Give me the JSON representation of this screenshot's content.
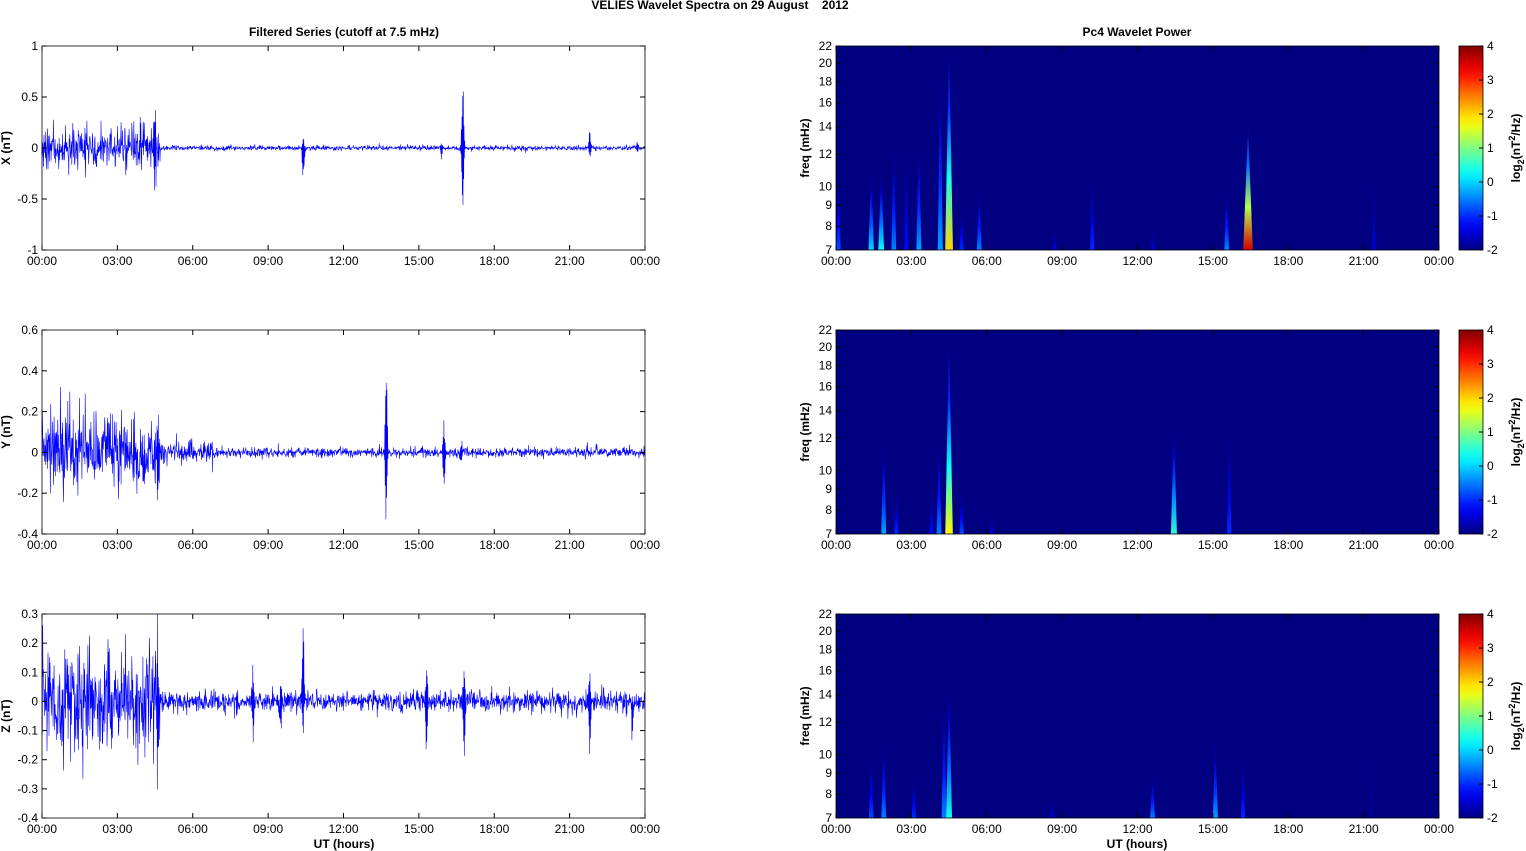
{
  "title": "VELIES Wavelet Spectra on 29 August    2012",
  "left_title": "Filtered Series (cutoff at 7.5 mHz)",
  "right_title": "Pc4 Wavelet Power",
  "xlabel": "UT (hours)",
  "freq_label": "freq (mHz)",
  "colorbar_label": {
    "a": "log",
    "sub": "2",
    "b": "(nT",
    "sup": "2",
    "c": "/Hz)"
  },
  "chart_data": [
    {
      "type": "line",
      "name": "X",
      "ylabel": "X (nT)",
      "xlim": [
        0,
        24
      ],
      "ylim": [
        -1,
        1
      ],
      "yticks": [
        -1,
        -0.5,
        0,
        0.5,
        1
      ],
      "xticks": [
        0,
        3,
        6,
        9,
        12,
        15,
        18,
        21,
        24
      ],
      "xticklabels": [
        "00:00",
        "03:00",
        "06:00",
        "09:00",
        "12:00",
        "15:00",
        "18:00",
        "21:00",
        "00:00"
      ],
      "noise_envelope": [
        {
          "from": 0,
          "to": 4.7,
          "amp": 0.1
        },
        {
          "from": 4.7,
          "to": 24,
          "amp": 0.012
        }
      ],
      "spikes": [
        {
          "t": 10.4,
          "pos": 0.1,
          "neg": -0.35
        },
        {
          "t": 15.9,
          "pos": 0.08,
          "neg": -0.1
        },
        {
          "t": 16.75,
          "pos": 0.75,
          "neg": -0.67
        },
        {
          "t": 21.8,
          "pos": 0.18,
          "neg": -0.08
        },
        {
          "t": 23.7,
          "pos": 0.08,
          "neg": -0.05
        },
        {
          "t": 4.5,
          "pos": 0.28,
          "neg": -0.35
        }
      ]
    },
    {
      "type": "line",
      "name": "Y",
      "ylabel": "Y (nT)",
      "xlim": [
        0,
        24
      ],
      "ylim": [
        -0.4,
        0.6
      ],
      "yticks": [
        -0.4,
        -0.2,
        0,
        0.2,
        0.4,
        0.6
      ],
      "xticks": [
        0,
        3,
        6,
        9,
        12,
        15,
        18,
        21,
        24
      ],
      "xticklabels": [
        "00:00",
        "03:00",
        "06:00",
        "09:00",
        "12:00",
        "15:00",
        "18:00",
        "21:00",
        "00:00"
      ],
      "noise_envelope": [
        {
          "from": 0,
          "to": 4.7,
          "amp": 0.09
        },
        {
          "from": 4.7,
          "to": 7,
          "amp": 0.025
        },
        {
          "from": 7,
          "to": 24,
          "amp": 0.012
        }
      ],
      "spikes": [
        {
          "t": 4.6,
          "pos": 0.25,
          "neg": -0.33
        },
        {
          "t": 13.7,
          "pos": 0.42,
          "neg": -0.36
        },
        {
          "t": 16.0,
          "pos": 0.15,
          "neg": -0.2
        },
        {
          "t": 16.7,
          "pos": 0.05,
          "neg": -0.08
        }
      ]
    },
    {
      "type": "line",
      "name": "Z",
      "ylabel": "Z (nT)",
      "xlim": [
        0,
        24
      ],
      "ylim": [
        -0.4,
        0.3
      ],
      "yticks": [
        -0.4,
        -0.3,
        -0.2,
        -0.1,
        0,
        0.1,
        0.2,
        0.3
      ],
      "xticks": [
        0,
        3,
        6,
        9,
        12,
        15,
        18,
        21,
        24
      ],
      "xticklabels": [
        "00:00",
        "03:00",
        "06:00",
        "09:00",
        "12:00",
        "15:00",
        "18:00",
        "21:00",
        "00:00"
      ],
      "noise_envelope": [
        {
          "from": 0,
          "to": 4.7,
          "amp": 0.09
        },
        {
          "from": 4.7,
          "to": 24,
          "amp": 0.018
        }
      ],
      "spikes": [
        {
          "t": 4.6,
          "pos": 0.2,
          "neg": -0.26
        },
        {
          "t": 8.4,
          "pos": 0.09,
          "neg": -0.14
        },
        {
          "t": 9.5,
          "pos": 0.05,
          "neg": -0.15
        },
        {
          "t": 10.4,
          "pos": 0.28,
          "neg": -0.12
        },
        {
          "t": 15.3,
          "pos": 0.15,
          "neg": -0.22
        },
        {
          "t": 16.8,
          "pos": 0.13,
          "neg": -0.2
        },
        {
          "t": 21.8,
          "pos": 0.13,
          "neg": -0.2
        },
        {
          "t": 23.5,
          "pos": 0.03,
          "neg": -0.1
        }
      ]
    },
    {
      "type": "heatmap",
      "name": "X power",
      "ylabel": "freq (mHz)",
      "xlim": [
        0,
        24
      ],
      "ylim": [
        7,
        22
      ],
      "yscale": "log",
      "yticks": [
        7,
        8,
        9,
        10,
        12,
        14,
        16,
        18,
        20,
        22
      ],
      "clim": [
        -2,
        4
      ],
      "cticks": [
        -2,
        -1,
        0,
        1,
        2,
        3,
        4
      ],
      "xticks": [
        0,
        3,
        6,
        9,
        12,
        15,
        18,
        21,
        24
      ],
      "xticklabels": [
        "00:00",
        "03:00",
        "06:00",
        "09:00",
        "12:00",
        "15:00",
        "18:00",
        "21:00",
        "00:00"
      ],
      "bursts": [
        {
          "t": 0.1,
          "fmax": 11,
          "p": -0.8
        },
        {
          "t": 1.4,
          "fmax": 11,
          "p": 0
        },
        {
          "t": 1.8,
          "fmax": 11,
          "p": 0.3
        },
        {
          "t": 2.3,
          "fmax": 13,
          "p": -0.5
        },
        {
          "t": 2.8,
          "fmax": 13,
          "p": -1.2
        },
        {
          "t": 3.3,
          "fmax": 13,
          "p": -0.3
        },
        {
          "t": 4.15,
          "fmax": 20,
          "p": -0.3
        },
        {
          "t": 4.5,
          "fmax": 22,
          "p": 2
        },
        {
          "t": 5.0,
          "fmax": 9,
          "p": -1
        },
        {
          "t": 5.7,
          "fmax": 10,
          "p": -0.5
        },
        {
          "t": 8.7,
          "fmax": 8,
          "p": -1.5
        },
        {
          "t": 10.2,
          "fmax": 11,
          "p": -1
        },
        {
          "t": 12.6,
          "fmax": 8,
          "p": -1.5
        },
        {
          "t": 15.55,
          "fmax": 10,
          "p": -0.5
        },
        {
          "t": 16.4,
          "fmax": 14,
          "p": 3.5
        },
        {
          "t": 21.4,
          "fmax": 11,
          "p": -1.5
        }
      ]
    },
    {
      "type": "heatmap",
      "name": "Y power",
      "ylabel": "freq (mHz)",
      "xlim": [
        0,
        24
      ],
      "ylim": [
        7,
        22
      ],
      "yscale": "log",
      "yticks": [
        7,
        8,
        9,
        10,
        12,
        14,
        16,
        18,
        20,
        22
      ],
      "clim": [
        -2,
        4
      ],
      "cticks": [
        -2,
        -1,
        0,
        1,
        2,
        3,
        4
      ],
      "xticks": [
        0,
        3,
        6,
        9,
        12,
        15,
        18,
        21,
        24
      ],
      "xticklabels": [
        "00:00",
        "03:00",
        "06:00",
        "09:00",
        "12:00",
        "15:00",
        "18:00",
        "21:00",
        "00:00"
      ],
      "bursts": [
        {
          "t": 1.9,
          "fmax": 12,
          "p": -0.3
        },
        {
          "t": 2.4,
          "fmax": 9,
          "p": -1
        },
        {
          "t": 3.8,
          "fmax": 9,
          "p": -1.2
        },
        {
          "t": 4.1,
          "fmax": 12,
          "p": -0.5
        },
        {
          "t": 4.5,
          "fmax": 21,
          "p": 1.8
        },
        {
          "t": 5.0,
          "fmax": 9,
          "p": -0.8
        },
        {
          "t": 6.2,
          "fmax": 8,
          "p": -1.5
        },
        {
          "t": 13.45,
          "fmax": 13,
          "p": 0.5
        },
        {
          "t": 15.65,
          "fmax": 13,
          "p": -1
        }
      ]
    },
    {
      "type": "heatmap",
      "name": "Z power",
      "ylabel": "freq (mHz)",
      "xlim": [
        0,
        24
      ],
      "ylim": [
        7,
        22
      ],
      "yscale": "log",
      "yticks": [
        7,
        8,
        9,
        10,
        12,
        14,
        16,
        18,
        20,
        22
      ],
      "clim": [
        -2,
        4
      ],
      "cticks": [
        -2,
        -1,
        0,
        1,
        2,
        3,
        4
      ],
      "xticks": [
        0,
        3,
        6,
        9,
        12,
        15,
        18,
        21,
        24
      ],
      "xticklabels": [
        "00:00",
        "03:00",
        "06:00",
        "09:00",
        "12:00",
        "15:00",
        "18:00",
        "21:00",
        "00:00"
      ],
      "bursts": [
        {
          "t": 1.4,
          "fmax": 10,
          "p": -0.8
        },
        {
          "t": 1.9,
          "fmax": 11,
          "p": -0.5
        },
        {
          "t": 3.1,
          "fmax": 9,
          "p": -1
        },
        {
          "t": 4.3,
          "fmax": 14,
          "p": -0.5
        },
        {
          "t": 4.5,
          "fmax": 15,
          "p": 0.4
        },
        {
          "t": 8.6,
          "fmax": 8,
          "p": -1.5
        },
        {
          "t": 12.6,
          "fmax": 9,
          "p": -0.5
        },
        {
          "t": 15.1,
          "fmax": 11,
          "p": -0.3
        },
        {
          "t": 16.2,
          "fmax": 10,
          "p": -1
        },
        {
          "t": 21.3,
          "fmax": 11,
          "p": -1.8
        }
      ]
    }
  ]
}
